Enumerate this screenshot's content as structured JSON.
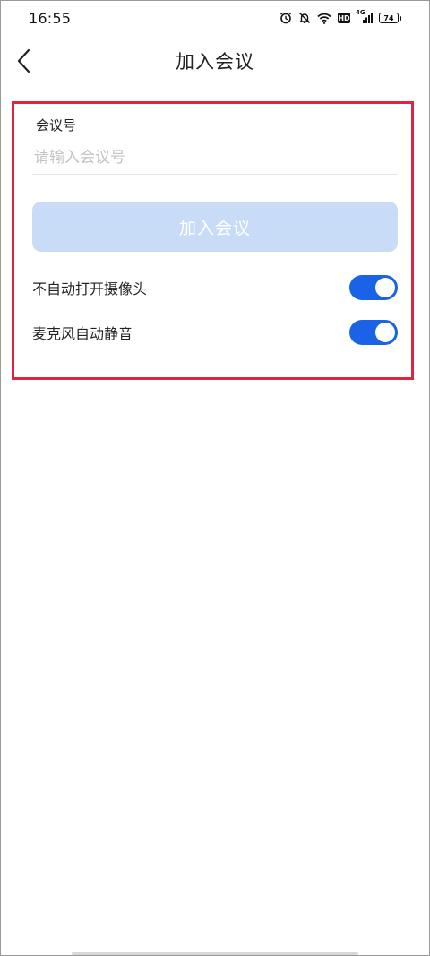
{
  "status_bar": {
    "time": "16:55",
    "network": "4G",
    "hd": "HD",
    "battery": "74"
  },
  "header": {
    "title": "加入会议"
  },
  "form": {
    "meeting_id_label": "会议号",
    "meeting_id_value": "",
    "meeting_id_placeholder": "请输入会议号",
    "join_label": "加入会议"
  },
  "options": [
    {
      "label": "不自动打开摄像头",
      "enabled": true
    },
    {
      "label": "麦克风自动静音",
      "enabled": true
    }
  ],
  "colors": {
    "accent": "#1b63e6",
    "join_button_disabled": "#c8dcf7",
    "highlight_border": "#e0263f"
  }
}
